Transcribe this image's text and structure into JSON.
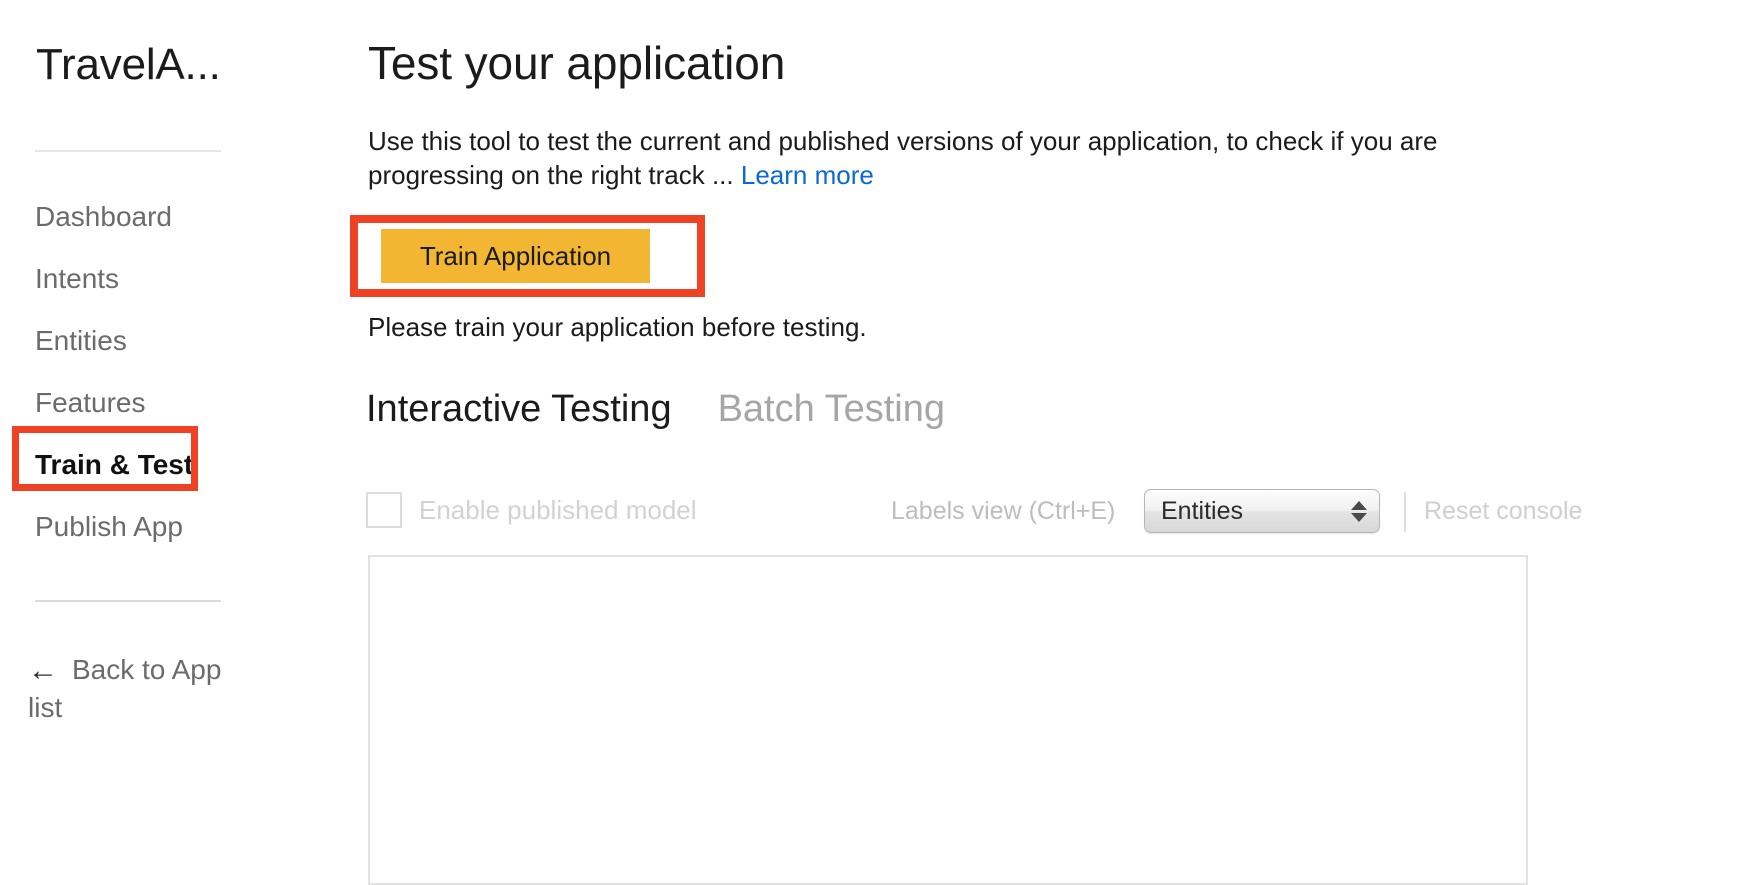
{
  "sidebar": {
    "app_title": "TravelA...",
    "items": [
      {
        "label": "Dashboard",
        "active": false
      },
      {
        "label": "Intents",
        "active": false
      },
      {
        "label": "Entities",
        "active": false
      },
      {
        "label": "Features",
        "active": false
      },
      {
        "label": "Train & Test",
        "active": true
      },
      {
        "label": "Publish App",
        "active": false
      }
    ],
    "back_link": {
      "icon": "arrow-left-icon",
      "glyph": "←",
      "label": "Back to App list"
    }
  },
  "main": {
    "page_title": "Test your application",
    "description_part1": "Use this tool to test the current and published versions of your application, to check if you are progressing on the right track ... ",
    "learn_more_label": "Learn more",
    "train_button_label": "Train Application",
    "train_hint": "Please train your application before testing.",
    "tabs": [
      {
        "label": "Interactive Testing",
        "active": true
      },
      {
        "label": "Batch Testing",
        "active": false
      }
    ],
    "toolbar": {
      "enable_published_model_label": "Enable published model",
      "enable_published_model_checked": false,
      "labels_view_label": "Labels view (Ctrl+E)",
      "labels_view_value": "Entities",
      "labels_view_options": [
        "Entities"
      ],
      "reset_console_label": "Reset console"
    },
    "console_placeholder": ""
  },
  "annotations": {
    "highlight_color": "#ef4123",
    "targets": [
      "Train & Test",
      "Train Application"
    ]
  },
  "colors": {
    "accent_button": "#f2b632",
    "link": "#0b6ad1",
    "annotation_red": "#ef4123",
    "text_primary": "#1b1b1b",
    "text_muted": "#6b6b6b",
    "text_disabled": "#cfcfcf"
  }
}
